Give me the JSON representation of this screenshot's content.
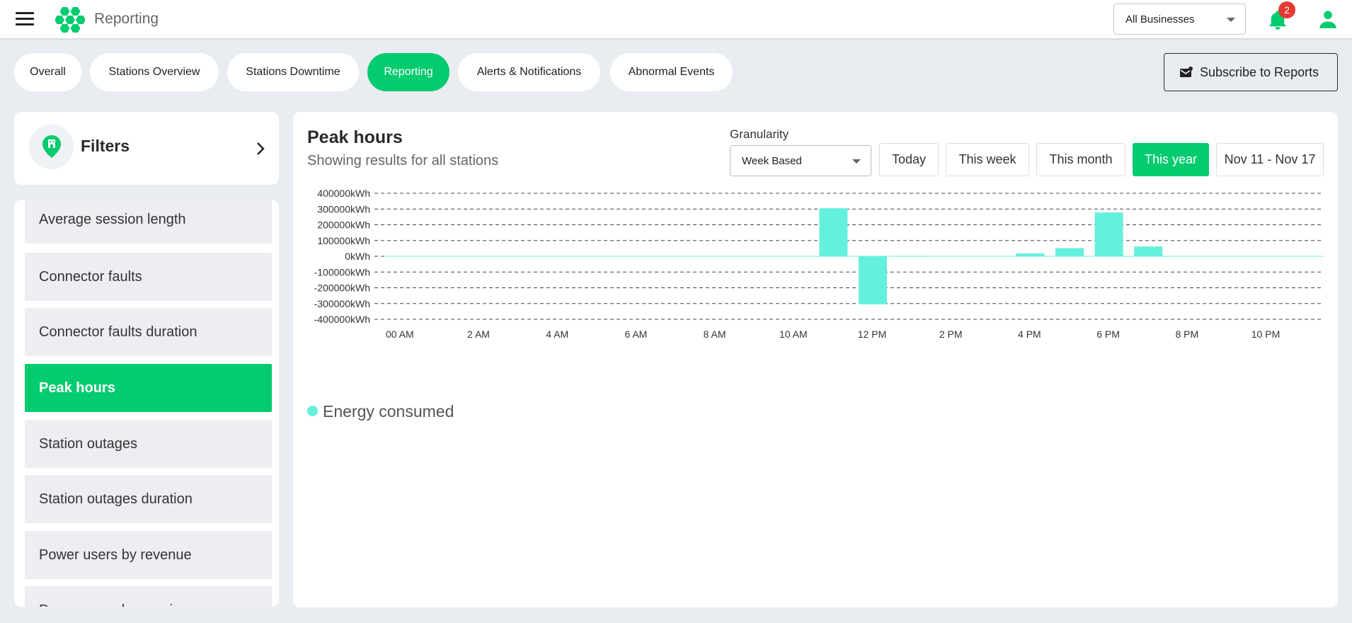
{
  "header": {
    "title": "Reporting",
    "business_select": "All Businesses",
    "notification_count": "2",
    "brand_color": "#05cb6f"
  },
  "tabs": [
    {
      "label": "Overall",
      "active": false
    },
    {
      "label": "Stations Overview",
      "active": false
    },
    {
      "label": "Stations Downtime",
      "active": false
    },
    {
      "label": "Reporting",
      "active": true
    },
    {
      "label": "Alerts & Notifications",
      "active": false
    },
    {
      "label": "Abnormal Events",
      "active": false
    }
  ],
  "subscribe_label": "Subscribe to Reports",
  "filters": {
    "label": "Filters"
  },
  "reports": [
    {
      "label": "Average session length",
      "active": false
    },
    {
      "label": "Connector faults",
      "active": false
    },
    {
      "label": "Connector faults duration",
      "active": false
    },
    {
      "label": "Peak hours",
      "active": true
    },
    {
      "label": "Station outages",
      "active": false
    },
    {
      "label": "Station outages duration",
      "active": false
    },
    {
      "label": "Power users by revenue",
      "active": false
    },
    {
      "label": "Power users by sessions",
      "active": false
    }
  ],
  "panel": {
    "title": "Peak hours",
    "subtitle": "Showing results for all stations",
    "granularity_label": "Granularity",
    "granularity_value": "Week Based",
    "ranges": [
      {
        "label": "Today",
        "active": false
      },
      {
        "label": "This week",
        "active": false
      },
      {
        "label": "This month",
        "active": false
      },
      {
        "label": "This year",
        "active": true
      },
      {
        "label": "Nov 11 - Nov 17",
        "active": false
      }
    ]
  },
  "chart_data": {
    "type": "bar",
    "categories": [
      "00 AM",
      "1 AM",
      "2 AM",
      "3 AM",
      "4 AM",
      "5 AM",
      "6 AM",
      "7 AM",
      "8 AM",
      "9 AM",
      "10 AM",
      "11 AM",
      "12 PM",
      "1 PM",
      "2 PM",
      "3 PM",
      "4 PM",
      "5 PM",
      "6 PM",
      "7 PM",
      "8 PM",
      "9 PM",
      "10 PM",
      "11 PM"
    ],
    "x_tick_labels": [
      "00 AM",
      "2 AM",
      "4 AM",
      "6 AM",
      "8 AM",
      "10 AM",
      "12 PM",
      "2 PM",
      "4 PM",
      "6 PM",
      "8 PM",
      "10 PM"
    ],
    "series": [
      {
        "name": "Energy consumed",
        "color": "#64f0dc",
        "values": [
          0,
          0,
          0,
          0,
          0,
          0,
          0,
          0,
          0,
          0,
          0,
          305000,
          -305000,
          3000,
          0,
          0,
          18000,
          52000,
          278000,
          62000,
          0,
          0,
          0,
          0
        ]
      }
    ],
    "y_ticks": [
      400000,
      300000,
      200000,
      100000,
      0,
      -100000,
      -200000,
      -300000,
      -400000
    ],
    "y_unit": "kWh",
    "ylim": [
      -400000,
      400000
    ],
    "grid": true,
    "legend_position": "bottom-left"
  }
}
